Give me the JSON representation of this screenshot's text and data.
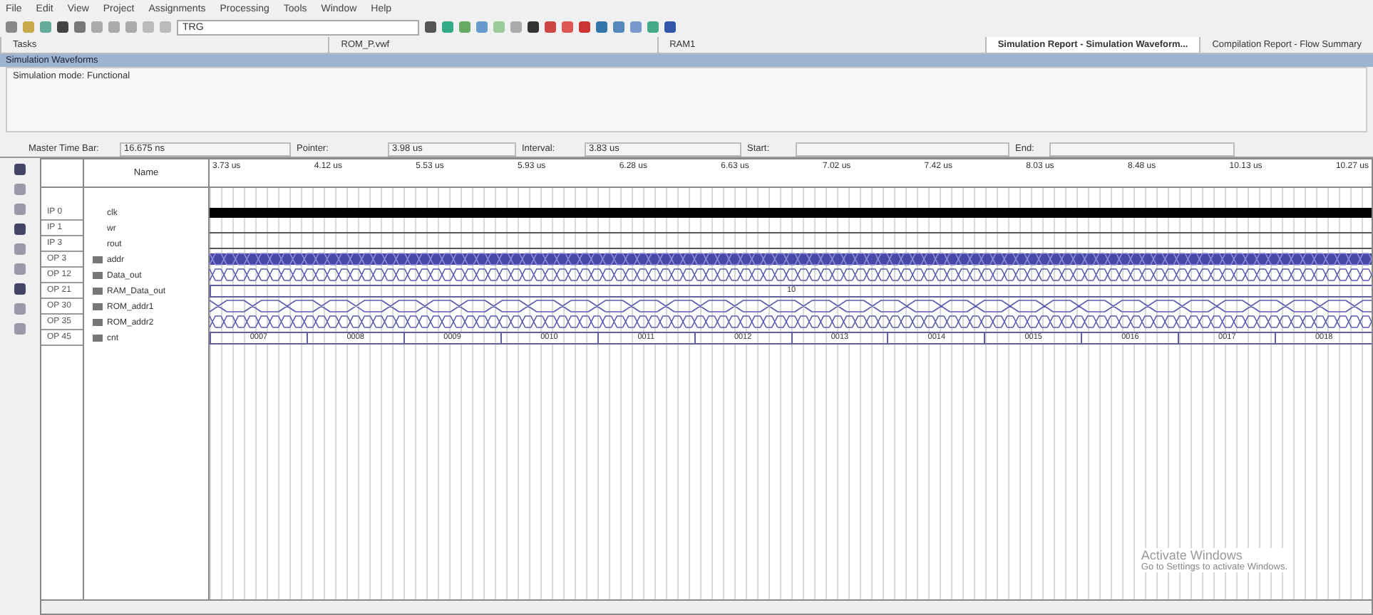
{
  "menu": [
    "File",
    "Edit",
    "View",
    "Project",
    "Assignments",
    "Processing",
    "Tools",
    "Window",
    "Help"
  ],
  "toolbar": {
    "combo_value": "TRG"
  },
  "tabs": [
    {
      "label": "Tasks",
      "selected": false
    },
    {
      "label": "ROM_P.vwf",
      "selected": false
    },
    {
      "label": "RAM1",
      "selected": false
    },
    {
      "label": "Simulation Report - Simulation Waveform...",
      "selected": true
    },
    {
      "label": "Compilation Report - Flow Summary",
      "selected": false
    }
  ],
  "section_title": "Simulation Waveforms",
  "simulation_mode": "Simulation mode: Functional",
  "time_bar": {
    "master_label": "Master Time Bar:",
    "master_value": "16.675 ns",
    "pointer_label": "Pointer:",
    "pointer_value": "3.98 us",
    "interval_label": "Interval:",
    "interval_value": "3.83 us",
    "start_label": "Start:",
    "end_label": "End:"
  },
  "name_header": "Name",
  "ticks": [
    "3.73 us",
    "4.12 us",
    "5.53 us",
    "5.93 us",
    "6.28 us",
    "6.63 us",
    "7.02 us",
    "7.42 us",
    "8.03 us",
    "8.48 us",
    "10.13 us",
    "10.27 us"
  ],
  "signals": [
    {
      "id": "IP 0",
      "name": "clk",
      "kind": "clock",
      "bus": false
    },
    {
      "id": "IP 1",
      "name": "wr",
      "kind": "low",
      "bus": false
    },
    {
      "id": "IP 3",
      "name": "rout",
      "kind": "low",
      "bus": false
    },
    {
      "id": "OP 3",
      "name": "addr",
      "kind": "dense_dark",
      "bus": true
    },
    {
      "id": "OP 12",
      "name": "Data_out",
      "kind": "dense",
      "bus": true
    },
    {
      "id": "OP 21",
      "name": "RAM_Data_out",
      "kind": "values",
      "bus": true,
      "values": [
        "10"
      ]
    },
    {
      "id": "OP 30",
      "name": "ROM_addr1",
      "kind": "dense_wide",
      "bus": true
    },
    {
      "id": "OP 35",
      "name": "ROM_addr2",
      "kind": "dense",
      "bus": true
    },
    {
      "id": "OP 45",
      "name": "cnt",
      "kind": "values",
      "bus": true,
      "values": [
        "0007",
        "0008",
        "0009",
        "0010",
        "0011",
        "0012",
        "0013",
        "0014",
        "0015",
        "0016",
        "0017",
        "0018"
      ]
    }
  ],
  "activation": {
    "title": "Activate Windows",
    "message": "Go to Settings to activate Windows."
  }
}
